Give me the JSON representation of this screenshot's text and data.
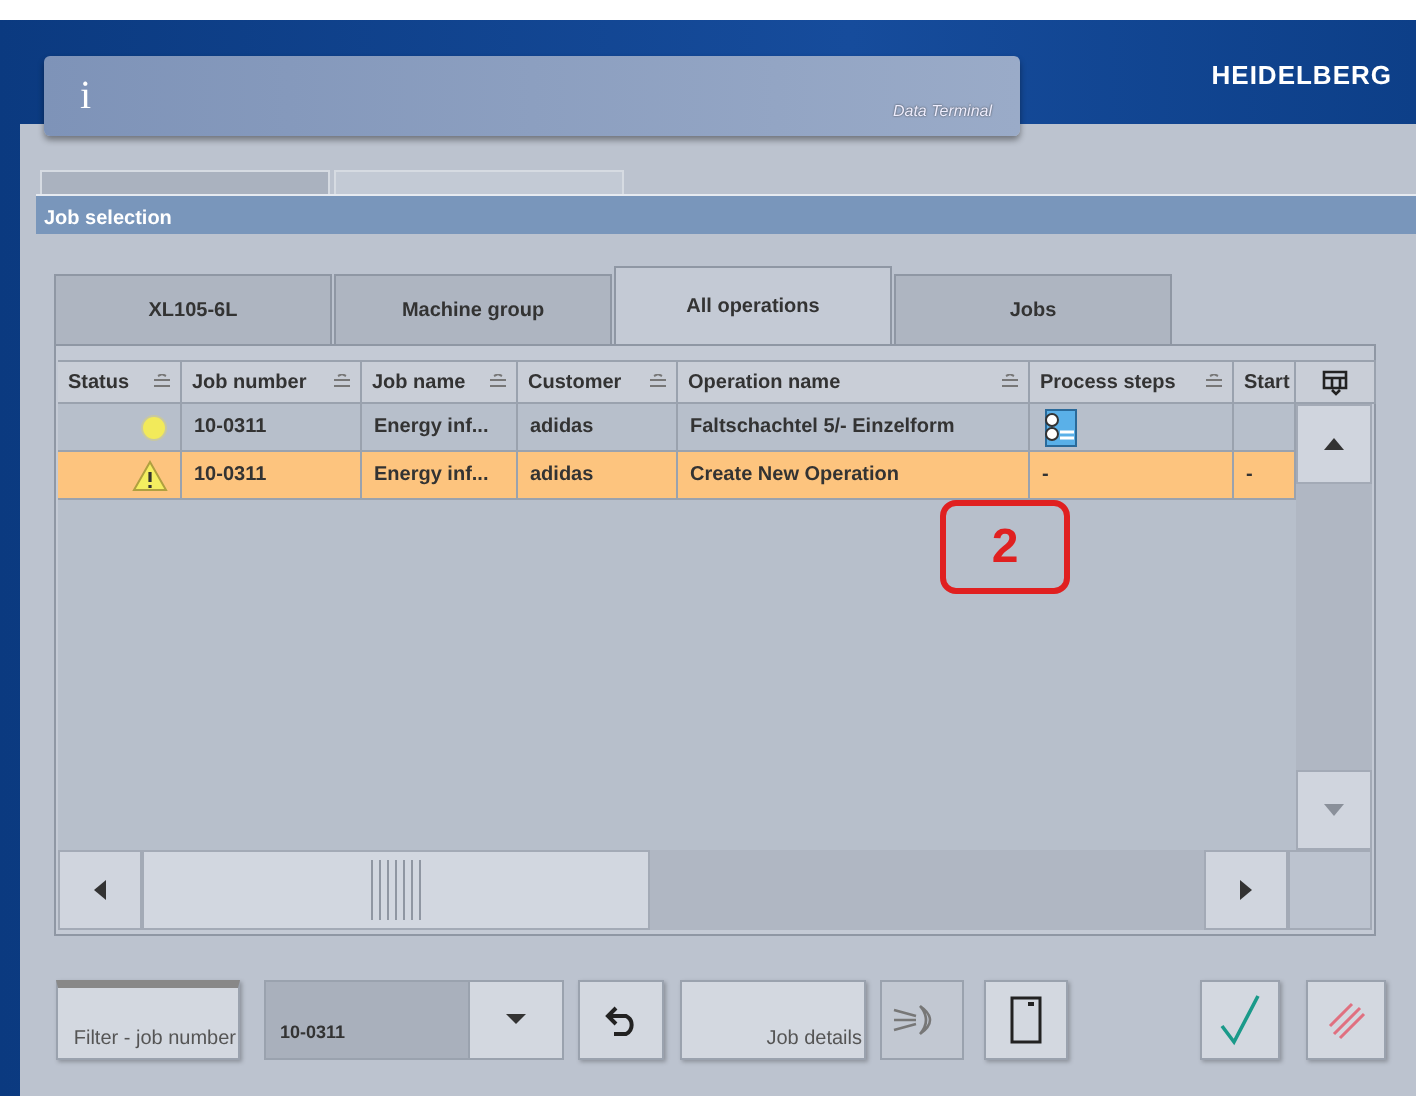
{
  "header": {
    "info_glyph": "i",
    "panel_title": "Data Terminal",
    "logo": "HEIDELBERG"
  },
  "window": {
    "title": "Job selection"
  },
  "tabs": [
    {
      "label": "XL105-6L",
      "selected": false
    },
    {
      "label": "Machine group",
      "selected": false
    },
    {
      "label": "All operations",
      "selected": true
    },
    {
      "label": "Jobs",
      "selected": false
    }
  ],
  "table": {
    "columns": [
      {
        "label": "Status",
        "sortable": true
      },
      {
        "label": "Job number",
        "sortable": true
      },
      {
        "label": "Job name",
        "sortable": true
      },
      {
        "label": "Customer",
        "sortable": true
      },
      {
        "label": "Operation name",
        "sortable": true
      },
      {
        "label": "Process steps",
        "sortable": true
      },
      {
        "label": "Start",
        "sortable": false
      }
    ],
    "rows": [
      {
        "warning": false,
        "selected": false,
        "job_number": "10-0311",
        "job_name": "Energy inf...",
        "customer": "adidas",
        "operation_name": "Faltschachtel 5/- Einzelform",
        "process_steps": {
          "kind": "icon"
        }
      },
      {
        "warning": true,
        "selected": true,
        "job_number": "10-0311",
        "job_name": "Energy inf...",
        "customer": "adidas",
        "operation_name": "Create New Operation",
        "process_steps": {
          "kind": "text",
          "text": "-"
        },
        "start": "-"
      }
    ]
  },
  "toolbar": {
    "filter_button": "Filter - job number",
    "job_number_value": "10-0311",
    "job_details_button": "Job details",
    "preview_disabled": true
  },
  "annotation": "2"
}
